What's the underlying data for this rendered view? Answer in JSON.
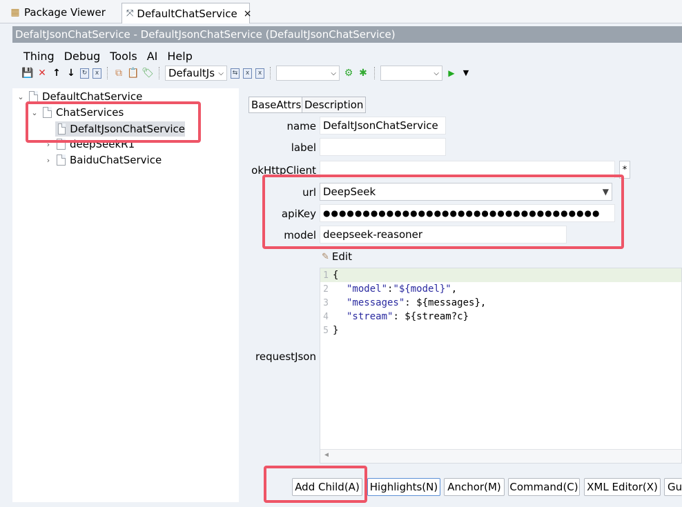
{
  "tabs": [
    {
      "label": "Package Viewer"
    },
    {
      "label": "DefaultChatService",
      "close": "×"
    }
  ],
  "title": "DefaltJsonChatService - DefaultJsonChatService  (DefaultJsonChatService)",
  "menu": [
    "Thing",
    "Debug",
    "Tools",
    "AI",
    "Help"
  ],
  "toolbar": {
    "combo1": "DefaultJs",
    "combo2": "",
    "combo3": ""
  },
  "tree": {
    "root": "DefaultChatService",
    "group": "ChatServices",
    "selected": "DefaltJsonChatService",
    "item2": "deepSeekR1",
    "item3": "BaiduChatService"
  },
  "form": {
    "tabs": [
      "BaseAttrs",
      "Description"
    ],
    "labels": {
      "name": "name",
      "label": "label",
      "okhttp": "okHttpClient",
      "url": "url",
      "apikey": "apiKey",
      "model": "model",
      "request": "requestJson"
    },
    "values": {
      "name": "DefaltJsonChatService",
      "label": "",
      "okhttp": "",
      "url": "DeepSeek",
      "apikey": "●●●●●●●●●●●●●●●●●●●●●●●●●●●●●●●●●●●",
      "model": "deepseek-reasoner"
    },
    "okhttp_btn": "*",
    "edit_label": "Edit"
  },
  "code": [
    {
      "n": "1",
      "text": "{"
    },
    {
      "n": "2",
      "key": "\"model\"",
      "rest": ": ",
      "val": "\"${model}\"",
      "tail": ","
    },
    {
      "n": "3",
      "key": "\"messages\"",
      "rest": ": ${messages},",
      "val": "",
      "tail": ""
    },
    {
      "n": "4",
      "key": "\"stream\"",
      "rest": ": ${stream?c}",
      "val": "",
      "tail": ""
    },
    {
      "n": "5",
      "text": "}"
    }
  ],
  "buttons": [
    "Add Child(A)",
    "Highlights(N)",
    "Anchor(M)",
    "Command(C)",
    "XML Editor(X)",
    "Gu"
  ],
  "colors": {
    "highlight": "#ee5567",
    "titlebar": "#9aa3ad",
    "string": "#2a2aa0"
  }
}
